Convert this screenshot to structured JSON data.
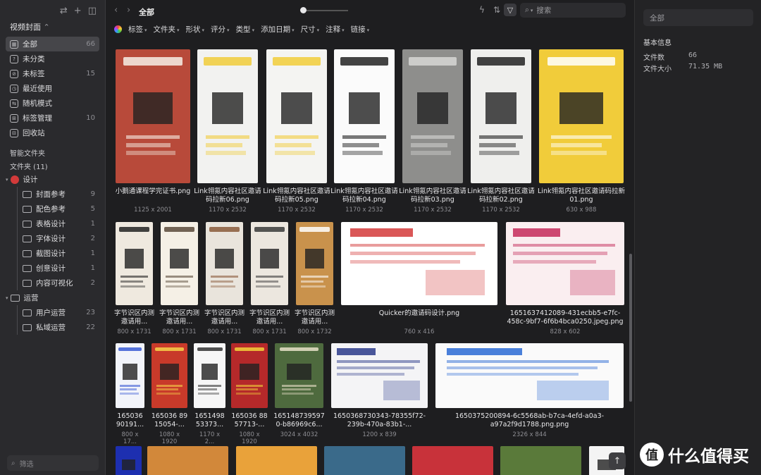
{
  "sidebar": {
    "library_name": "视频封面",
    "items": [
      {
        "label": "全部",
        "count": "66"
      },
      {
        "label": "未分类",
        "count": ""
      },
      {
        "label": "未标签",
        "count": "15"
      },
      {
        "label": "最近使用",
        "count": ""
      },
      {
        "label": "随机模式",
        "count": ""
      },
      {
        "label": "标签管理",
        "count": "10"
      },
      {
        "label": "回收站",
        "count": ""
      }
    ],
    "smart_folders_label": "智能文件夹",
    "folders_label": "文件夹 (11)",
    "folders": [
      {
        "label": "设计",
        "count": "",
        "level": 0
      },
      {
        "label": "封面参考",
        "count": "9",
        "level": 1
      },
      {
        "label": "配色参考",
        "count": "5",
        "level": 1
      },
      {
        "label": "表格设计",
        "count": "1",
        "level": 1
      },
      {
        "label": "字体设计",
        "count": "2",
        "level": 1
      },
      {
        "label": "截图设计",
        "count": "1",
        "level": 1
      },
      {
        "label": "创意设计",
        "count": "1",
        "level": 1
      },
      {
        "label": "内容可视化",
        "count": "2",
        "level": 1
      },
      {
        "label": "运营",
        "count": "",
        "level": 0
      },
      {
        "label": "用户运营",
        "count": "23",
        "level": 1
      },
      {
        "label": "私域运营",
        "count": "22",
        "level": 1
      }
    ],
    "filter_placeholder": "筛选"
  },
  "toolbar": {
    "title": "全部",
    "search_placeholder": "搜索"
  },
  "filters": [
    "标签",
    "文件夹",
    "形状",
    "评分",
    "类型",
    "添加日期",
    "尺寸",
    "注释",
    "链接"
  ],
  "grid": {
    "row1": [
      {
        "name": "小鹅通课程学完证书.png",
        "dims": "1125 x 2001",
        "bg": "#b84a3a",
        "fg": "#f6efe6"
      },
      {
        "name": "Link翎氪内容社区邀请码拉新06.png",
        "dims": "1170 x 2532",
        "bg": "#f2f2f0",
        "fg": "#f1cc3a"
      },
      {
        "name": "Link翎氪内容社区邀请码拉新05.png",
        "dims": "1170 x 2532",
        "bg": "#f4f4f2",
        "fg": "#f1cc3a"
      },
      {
        "name": "Link翎氪内容社区邀请码拉新04.png",
        "dims": "1170 x 2532",
        "bg": "#fbfbfb",
        "fg": "#222222"
      },
      {
        "name": "Link翎氪内容社区邀请码拉新03.png",
        "dims": "1170 x 2532",
        "bg": "#8e8e8c",
        "fg": "#d7d7d5"
      },
      {
        "name": "Link翎氪内容社区邀请码拉新02.png",
        "dims": "1170 x 2532",
        "bg": "#efefed",
        "fg": "#222222"
      },
      {
        "name": "Link翎氪内容社区邀请码拉新01.png",
        "dims": "630 x 988",
        "bg": "#f1cc3a",
        "fg": "#ffffff"
      }
    ],
    "row2": [
      {
        "name": "字节识区内测邀请用...",
        "dims": "800 x 1731",
        "bg": "#efe9df",
        "fg": "#222222"
      },
      {
        "name": "字节识区内测邀请用...",
        "dims": "800 x 1731",
        "bg": "#f5f0e6",
        "fg": "#5a4a3a"
      },
      {
        "name": "字节识区内测邀请用...",
        "dims": "800 x 1731",
        "bg": "#e9e4dc",
        "fg": "#8a5a3a"
      },
      {
        "name": "字节识区内测邀请用...",
        "dims": "800 x 1731",
        "bg": "#ece7df",
        "fg": "#3a3a3a"
      },
      {
        "name": "字节识区内测邀请用...",
        "dims": "800 x 1732",
        "bg": "#c9924c",
        "fg": "#ffffff"
      },
      {
        "name": "Quicker的邀请码设计.png",
        "dims": "760 x 416",
        "bg": "#ffffff",
        "fg": "#d43a3a"
      },
      {
        "name": "1651637412089-431ecbb5-e7fc-458c-9bf7-6f6b4bca0250.jpeg.png",
        "dims": "828 x 602",
        "bg": "#faeef0",
        "fg": "#c42a5a"
      }
    ],
    "row3": [
      {
        "name": "165036 90191...",
        "dims": "800 x 17...",
        "bg": "#f2f4fa",
        "fg": "#3a5ad4"
      },
      {
        "name": "165036 89 15054-...",
        "dims": "1080 x 1920",
        "bg": "#c83a2a",
        "fg": "#f6d24a"
      },
      {
        "name": "1651498 53373...",
        "dims": "1170 x 2...",
        "bg": "#f6f6f6",
        "fg": "#333333"
      },
      {
        "name": "165036 88 57713-...",
        "dims": "1080 x 1920",
        "bg": "#b5292a",
        "fg": "#f2d03a"
      },
      {
        "name": "165148739597 0-b86969c6...",
        "dims": "3024 x 4032",
        "bg": "#4e6a3e",
        "fg": "#e8e0c8"
      },
      {
        "name": "1650368730343-78355f72-239b-470a-83b1-...",
        "dims": "1200 x 839",
        "bg": "#f4f4f6",
        "fg": "#2a3a8a"
      },
      {
        "name": "1650375200894-6c5568ab-b7ca-4efd-a0a3-a97a2f9d1788.png.png",
        "dims": "2326 x 844",
        "bg": "#fafafa",
        "fg": "#2a6ad4"
      }
    ],
    "row4": [
      {
        "bg": "#1d2fb0"
      },
      {
        "bg": "#d2883a"
      },
      {
        "bg": "#e9a23a"
      },
      {
        "bg": "#3a6a8a"
      },
      {
        "bg": "#c8323a"
      },
      {
        "bg": "#5a7a3a"
      },
      {
        "bg": "#f4f4f4"
      }
    ]
  },
  "inspector": {
    "title_placeholder": "全部",
    "section": "基本信息",
    "file_count_label": "文件数",
    "file_count": "66",
    "file_size_label": "文件大小",
    "file_size": "71.35 MB"
  },
  "watermark": "什么值得买"
}
